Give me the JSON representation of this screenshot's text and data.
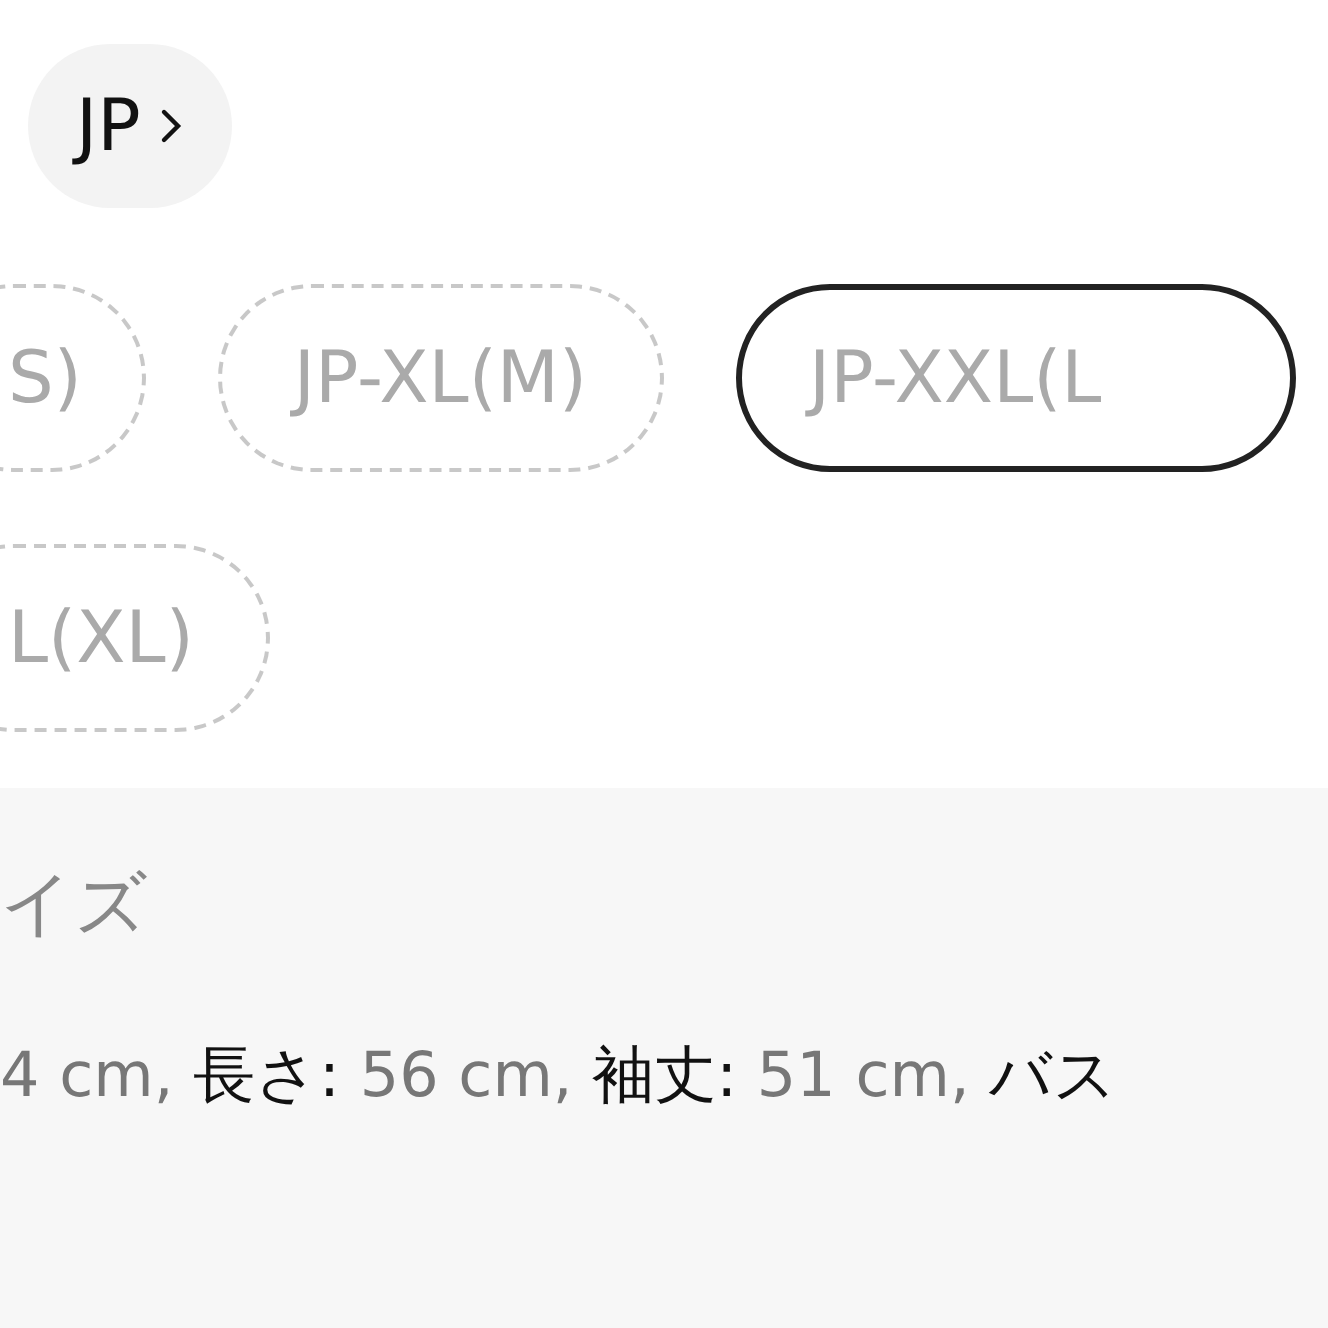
{
  "region": {
    "label": "JP"
  },
  "sizes": [
    {
      "label": "S)",
      "selected": false
    },
    {
      "label": "JP-XL(M)",
      "selected": false
    },
    {
      "label": "JP-XXL(L",
      "selected": true
    },
    {
      "label": "L(XL)",
      "selected": false
    }
  ],
  "details": {
    "title": "イズ",
    "measurements": [
      {
        "value": "4 cm,"
      },
      {
        "label": "長さ:",
        "value": "56 cm,"
      },
      {
        "label": "袖丈:",
        "value": "51 cm,"
      },
      {
        "label": "バス"
      }
    ]
  }
}
